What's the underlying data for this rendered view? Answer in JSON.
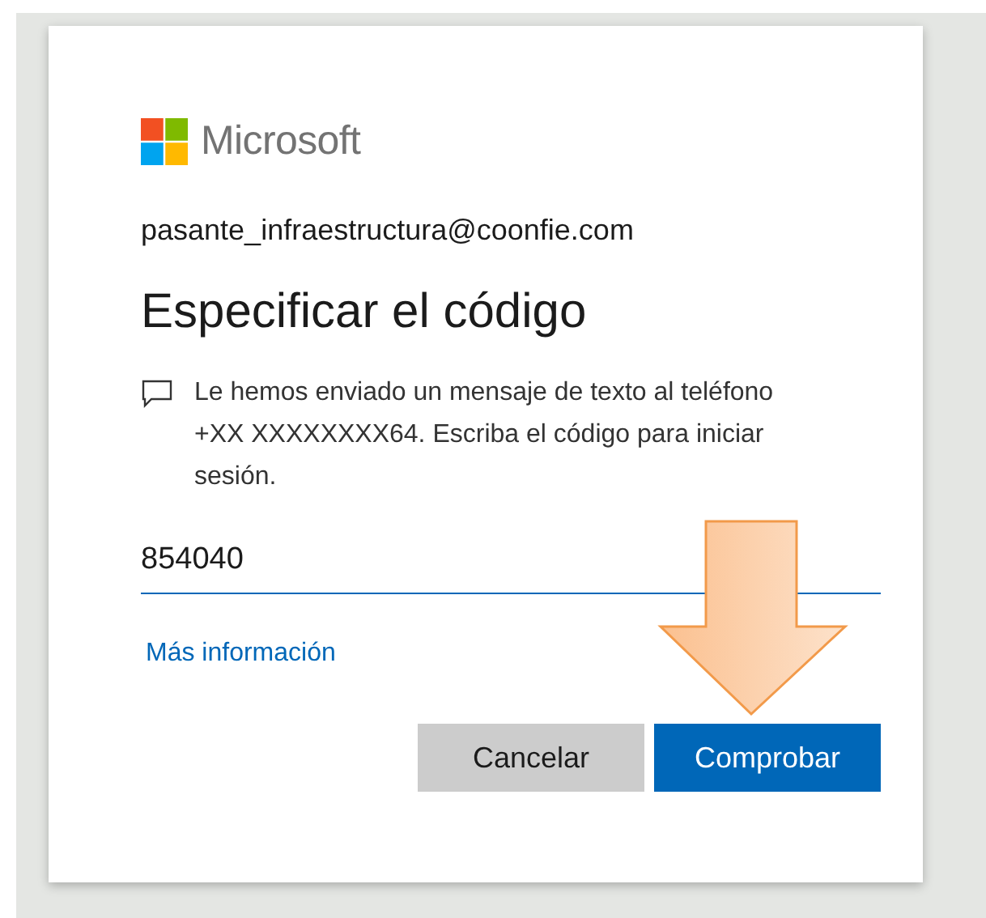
{
  "brand": {
    "name": "Microsoft"
  },
  "account": "pasante_infraestructura@coonfie.com",
  "title": "Especificar el código",
  "message": "Le hemos enviado un mensaje de texto al teléfono +XX XXXXXXXX64. Escriba el código para iniciar sesión.",
  "code_field": {
    "value": "854040"
  },
  "link": "Más información",
  "buttons": [
    {
      "label": "Cancelar",
      "kind": "secondary"
    },
    {
      "label": "Comprobar",
      "kind": "primary"
    }
  ],
  "annotation": {
    "kind": "down-arrow"
  }
}
